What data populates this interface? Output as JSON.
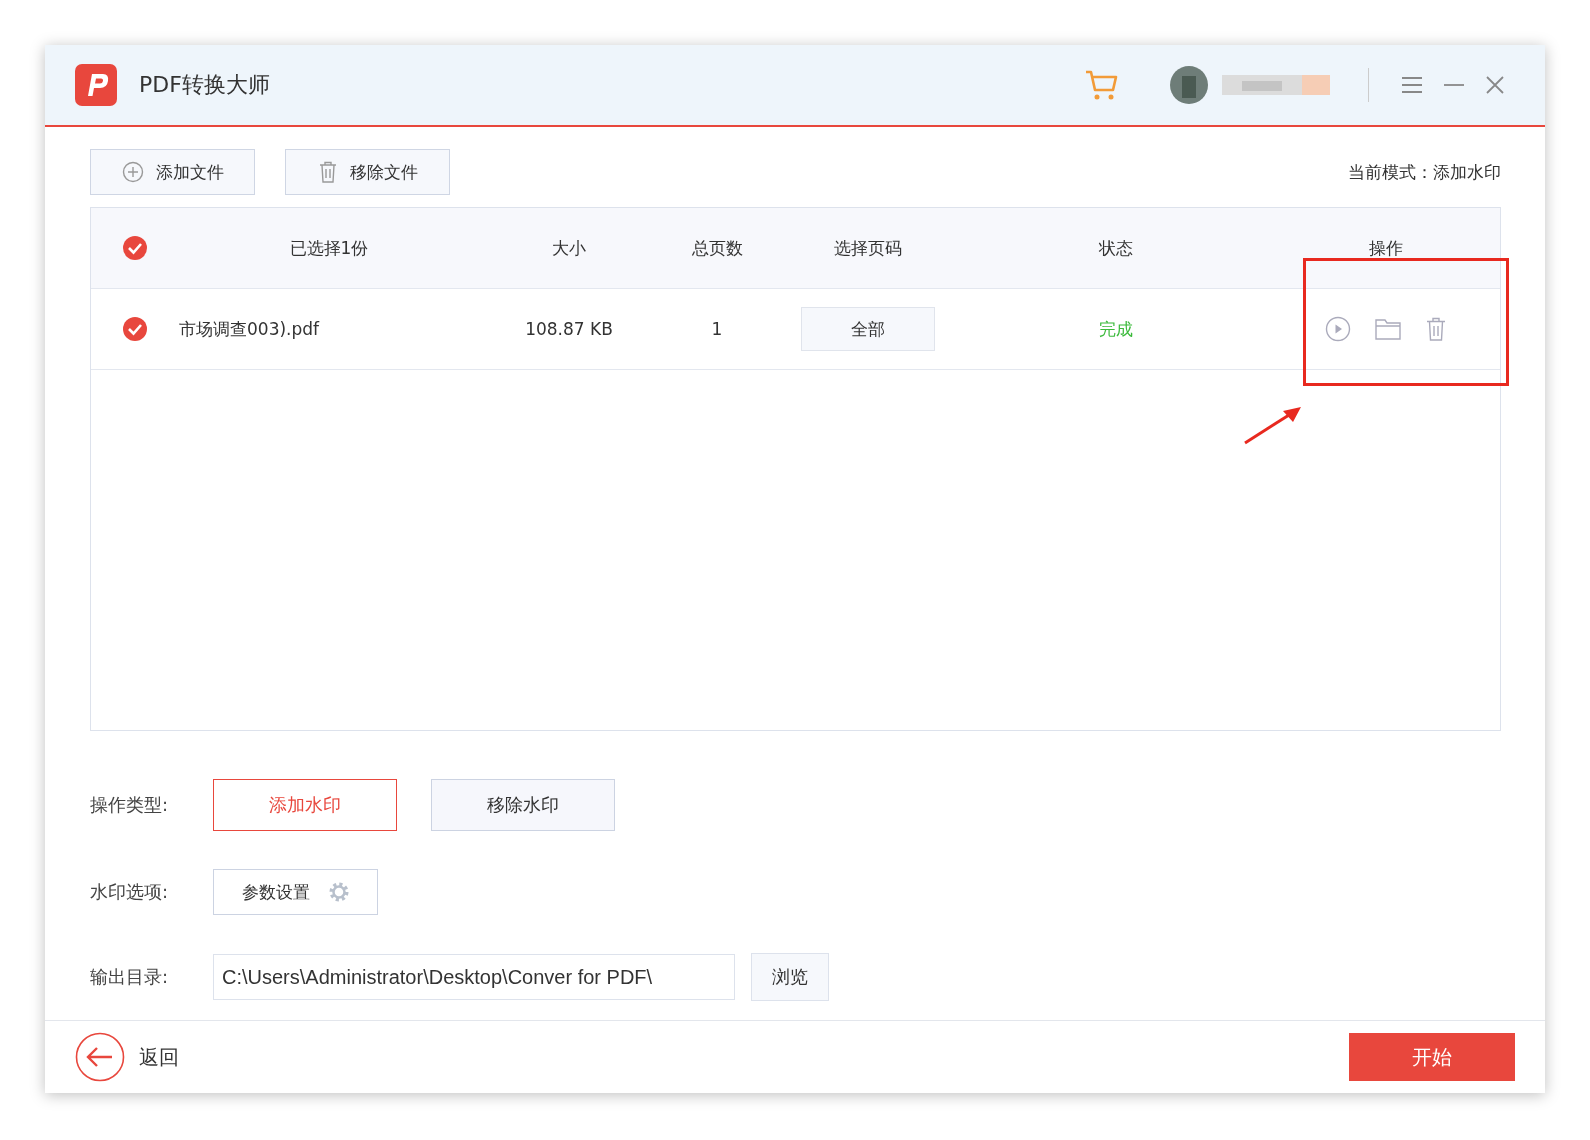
{
  "window": {
    "title": "PDF转换大师"
  },
  "toolbar": {
    "buttons": [
      {
        "kind": "add",
        "label": "添加文件"
      },
      {
        "kind": "remove",
        "label": "移除文件"
      }
    ],
    "mode": "当前模式：添加水印"
  },
  "table": {
    "select_all": {
      "checked": true
    },
    "columns": [
      "已选择1份",
      "大小",
      "总页数",
      "选择页码",
      "状态",
      "操作"
    ],
    "rows": [
      {
        "checked": true,
        "name": "市场调查003).pdf",
        "size": "108.87 KB",
        "pages": "1",
        "page_range": "全部",
        "status": "完成"
      }
    ]
  },
  "operation_type": {
    "label": "操作类型:",
    "options": [
      {
        "label": "添加水印",
        "selected": true
      },
      {
        "label": "移除水印",
        "selected": false
      }
    ]
  },
  "watermark_options": {
    "label": "水印选项:",
    "button": "参数设置"
  },
  "output_dir": {
    "label": "输出目录:",
    "value": "C:\\Users\\Administrator\\Desktop\\Conver for PDF\\",
    "browse": "浏览"
  },
  "footer": {
    "back": "返回",
    "start": "开始"
  }
}
